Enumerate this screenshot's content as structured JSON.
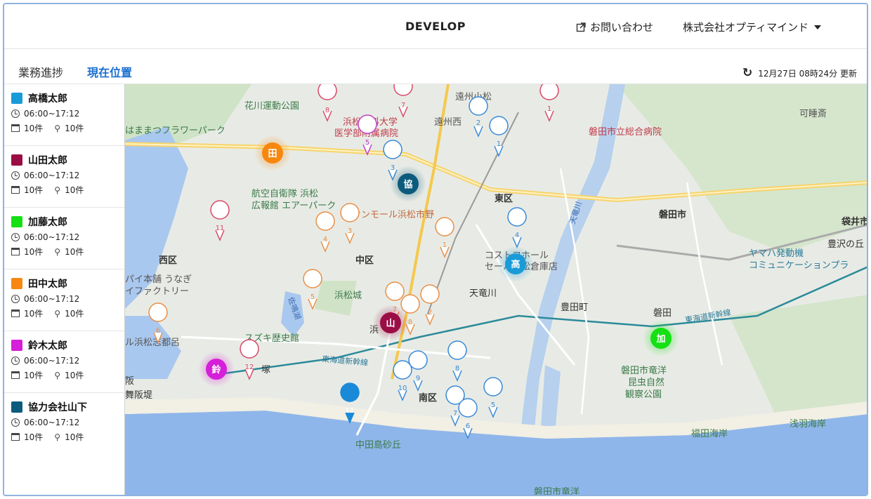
{
  "header": {
    "brand": "DEVELOP",
    "contact_label": "お問い合わせ",
    "company_label": "株式会社オプティマインド"
  },
  "tabs": [
    {
      "label": "業務進捗"
    },
    {
      "label": "現在位置"
    }
  ],
  "updated_text": "12月27日 08時24分 更新",
  "drivers": [
    {
      "name": "高橋太郎",
      "color": "#1a9bd8",
      "time": "06:00~17:12",
      "items": "10件",
      "points": "10件"
    },
    {
      "name": "山田太郎",
      "color": "#9b0d45",
      "time": "06:00~17:12",
      "items": "10件",
      "points": "10件"
    },
    {
      "name": "加藤太郎",
      "color": "#14e014",
      "time": "06:00~17:12",
      "items": "10件",
      "points": "10件"
    },
    {
      "name": "田中太郎",
      "color": "#f7870f",
      "time": "06:00~17:12",
      "items": "10件",
      "points": "10件"
    },
    {
      "name": "鈴木太郎",
      "color": "#d51fd8",
      "time": "06:00~17:12",
      "items": "10件",
      "points": "10件"
    },
    {
      "name": "協力会社山下",
      "color": "#0c5b7c",
      "time": "06:00~17:12",
      "items": "10件",
      "points": "10件"
    }
  ],
  "map": {
    "vehicles": [
      {
        "label": "田",
        "color": "#f7870f"
      },
      {
        "label": "協",
        "color": "#0c5b7c"
      },
      {
        "label": "高",
        "color": "#1a9bd8"
      },
      {
        "label": "山",
        "color": "#9b0d45"
      },
      {
        "label": "加",
        "color": "#14e014"
      },
      {
        "label": "鈴",
        "color": "#d51fd8"
      }
    ],
    "places": {
      "hamamatsu_flower_park": "はままつフラワーパーク",
      "hanakawa_park": "花川運動公園",
      "medical_univ_1": "浜松医科大学",
      "medical_univ_2": "医学部附属病院",
      "enshu_komatsu": "遠州小松",
      "enshu_nishi": "遠州西",
      "iwata_hospital": "磐田市立総合病院",
      "kamuto": "可睡斎",
      "jsdf_1": "航空自衛隊 浜松",
      "jsdf_2": "広報館 エアーパーク",
      "aeon": "イオンモール浜松市野",
      "higashi_ku": "東区",
      "iwata_city": "磐田市",
      "fukuroi": "袋井市",
      "nishi_ku": "西区",
      "naka_ku": "中区",
      "costco_1": "コストコホール",
      "costco_2": "セール浜松倉庫店",
      "yamaha_1": "ヤマハ発動機",
      "yamaha_2": "コミュニケーションプラ",
      "toyosawa": "豊沢の丘",
      "unagi_1": "パイ本舗 うなぎ",
      "unagi_2": "イファクトリー",
      "tenryu_gawa": "天竜川",
      "tenryu_river": "天竜川",
      "hamamatsu_castle": "浜松城",
      "sanaru_lake": "佐鳴湖",
      "suzuki": "スズキ歴史館",
      "toyodacho": "豊田町",
      "iwata_station": "磐田",
      "tokaido_1": "東海道新幹線",
      "tokaido_2": "東海道新幹線",
      "hama": "浜",
      "zuka": "塚",
      "hamanako": "ル浜松志都呂",
      "maisaka_1": "阪",
      "maisaka_2": "舞阪堤",
      "minami_ku": "南区",
      "nakatajima": "中田島砂丘",
      "insect_1": "磐田市竜洋",
      "insect_2": "昆虫自然",
      "insect_3": "観察公園",
      "fukude": "福田海岸",
      "asaba": "浅羽海岸",
      "ryuyo": "磐田市竜洋"
    }
  }
}
